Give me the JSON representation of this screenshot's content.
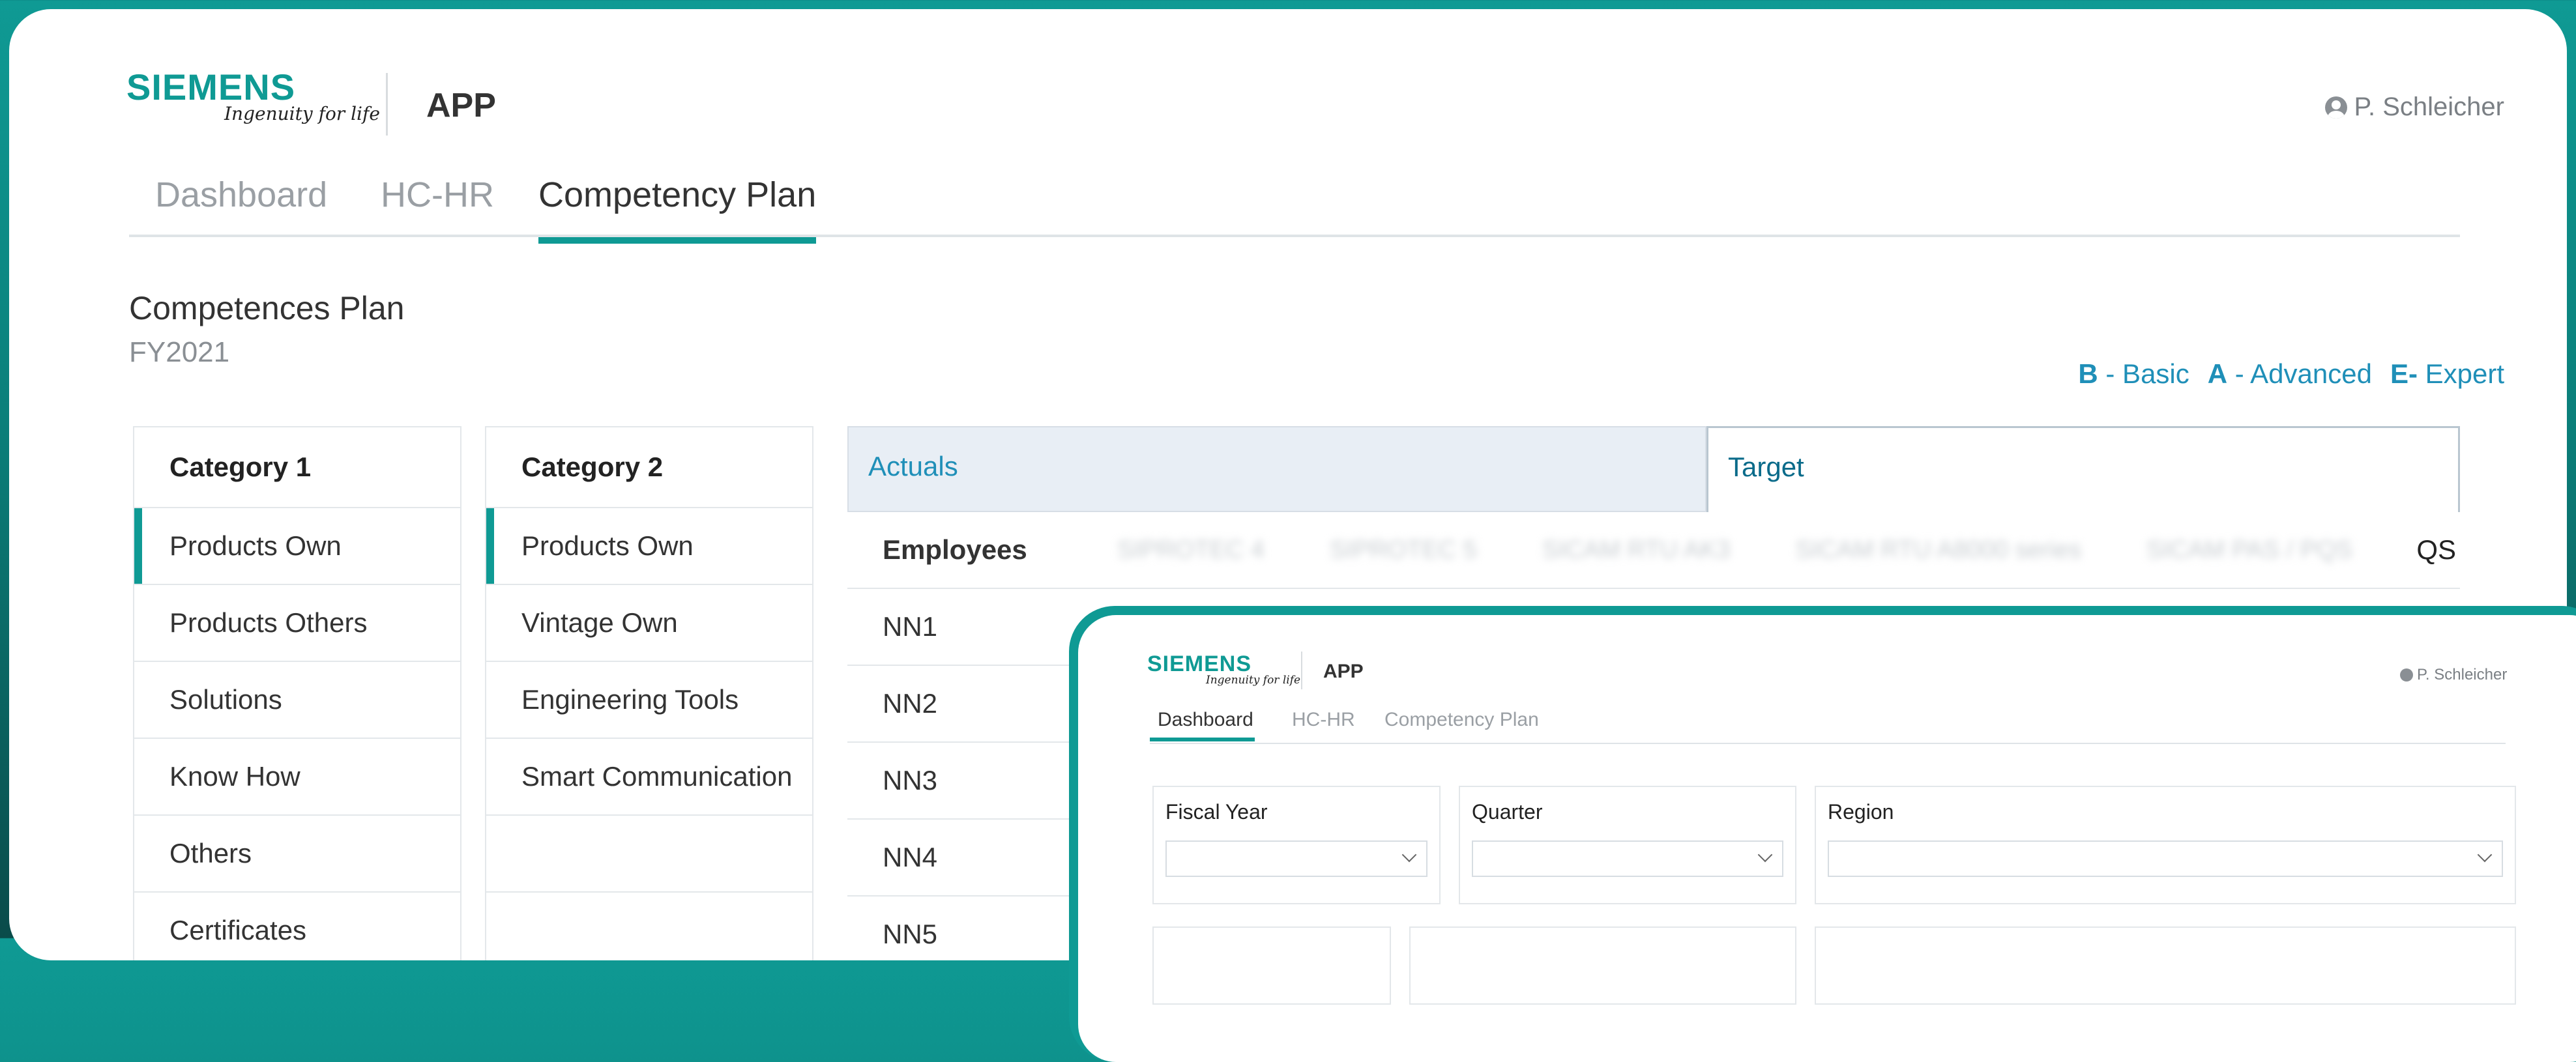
{
  "header": {
    "logo_word": "SIEMENS",
    "logo_tagline": "Ingenuity for life",
    "app_title": "APP",
    "user_name": "P. Schleicher"
  },
  "tabs": [
    {
      "label": "Dashboard"
    },
    {
      "label": "HC-HR"
    },
    {
      "label": "Competency Plan",
      "active": true
    }
  ],
  "section": {
    "title": "Competences Plan",
    "subtitle": "FY2021"
  },
  "legend": [
    {
      "key": "B",
      "label": "- Basic"
    },
    {
      "key": "A",
      "label": "- Advanced"
    },
    {
      "key": "E-",
      "label": "Expert"
    }
  ],
  "category1": {
    "header": "Category 1",
    "items": [
      "Products Own",
      "Products Others",
      "Solutions",
      "Know How",
      "Others",
      "Certificates"
    ]
  },
  "category2": {
    "header": "Category 2",
    "items": [
      "Products Own",
      "Vintage Own",
      "Engineering Tools",
      "Smart Communication",
      "",
      ""
    ]
  },
  "panel": {
    "tab_actuals": "Actuals",
    "tab_target": "Target",
    "col_employees": "Employees",
    "blurred_columns": [
      "SIPROTEC 4",
      "SIPROTEC 5",
      "SICAM RTU AK3",
      "SICAM RTU A8000 series",
      "SICAM PAS / PQS"
    ],
    "clipped_tail": "QS",
    "employees": [
      "NN1",
      "NN2",
      "NN3",
      "NN4",
      "NN5"
    ]
  },
  "preview": {
    "logo_word": "SIEMENS",
    "logo_tagline": "Ingenuity for life",
    "app_title": "APP",
    "user_name": "P. Schleicher",
    "tabs": [
      "Dashboard",
      "HC-HR",
      "Competency Plan"
    ],
    "filters": [
      "Fiscal Year",
      "Quarter",
      "Region"
    ]
  },
  "colors": {
    "brand": "#0f9a94",
    "link": "#1f8fb8",
    "actuals_bg": "#e8eef5"
  }
}
